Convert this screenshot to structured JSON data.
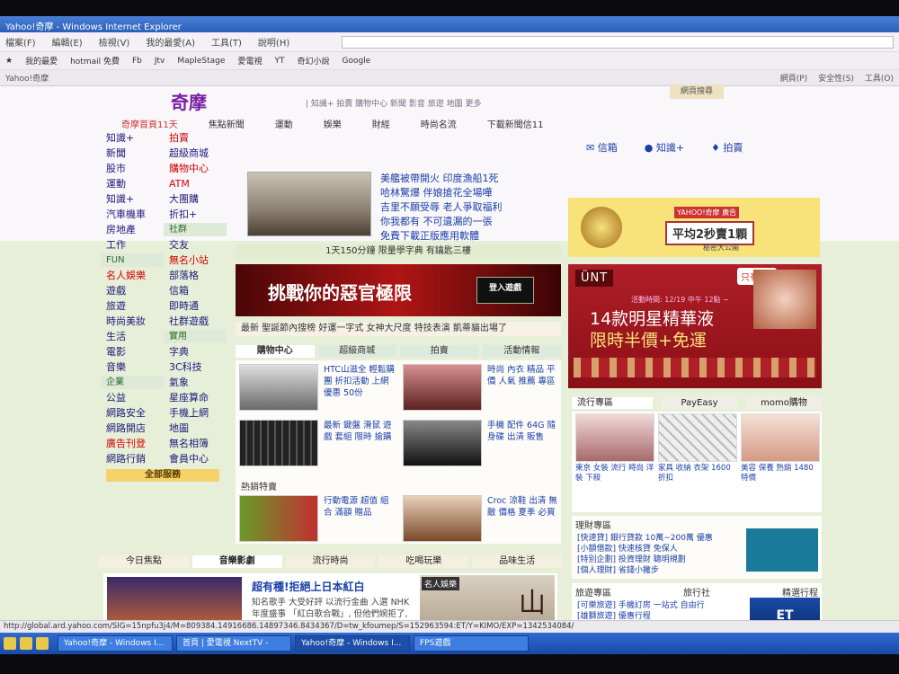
{
  "window": {
    "title": "Yahoo!奇摩 - Windows Internet Explorer"
  },
  "menubar": {
    "items": [
      "檔案(F)",
      "編輯(E)",
      "檢視(V)",
      "我的最愛(A)",
      "工具(T)",
      "說明(H)"
    ]
  },
  "favbar": {
    "items": [
      "我的最愛",
      "hotmail 免費",
      "Fb",
      "Jtv",
      "MapleStage",
      "愛電視",
      "YT",
      "奇幻小說",
      "Google"
    ]
  },
  "tabbar": {
    "tab": "Yahoo!奇摩",
    "tools": [
      "網頁(P)",
      "安全性(S)",
      "工具(O)"
    ]
  },
  "header": {
    "logo": "奇摩",
    "top_right": "網頁搜尋",
    "search_links": "| 知識+ 拍賣 購物中心 新聞 影音 旅遊 地圖 更多"
  },
  "navrow": [
    "奇摩首頁11天",
    "焦點新聞",
    "運動",
    "娛樂",
    "財經",
    "時尚名流",
    "下載新聞信11"
  ],
  "leftnav": {
    "rows": [
      [
        "知識+",
        "拍賣"
      ],
      [
        "新聞",
        "超級商城"
      ],
      [
        "股市",
        "購物中心"
      ],
      [
        "運動",
        "ATM"
      ],
      [
        "知識+",
        "大團購"
      ],
      [
        "汽車機車",
        "折扣+"
      ],
      [
        "房地產",
        "社群"
      ],
      [
        "工作",
        "交友"
      ],
      [
        "FUN",
        "無名小站"
      ],
      [
        "名人娛樂",
        "部落格"
      ],
      [
        "遊戲",
        "信箱"
      ],
      [
        "旅遊",
        "即時通"
      ],
      [
        "時尚美妝",
        "社群遊戲"
      ],
      [
        "生活",
        "實用"
      ],
      [
        "電影",
        "字典"
      ],
      [
        "音樂",
        "3C科技"
      ],
      [
        "企業",
        "氣象"
      ],
      [
        "公益",
        "星座算命"
      ],
      [
        "網路安全",
        "手機上網"
      ],
      [
        "網路開店",
        "地圖"
      ],
      [
        "廣告刊登",
        "無名相簿"
      ],
      [
        "網路行銷",
        "會員中心"
      ]
    ],
    "all_services": "全部服務"
  },
  "news": {
    "items": [
      "美艦被帶開火 印度漁船1死",
      "哈林驚爆 伴娘搶花全場嘩",
      "吉里不願受辱 老人爭取福利",
      "你我都有 不可遺漏的一張",
      "免費下載正版應用軟體"
    ]
  },
  "banner1": "1天150分鐘 限量學字典 有鑰匙三樓",
  "ad": {
    "headline": "挑戰你的惡官極限",
    "button": "登入遊戲"
  },
  "ticker": "最新 聖誕節內搜榜  好運一字式  女神大尺度  特技表演  凱蒂貓出場了",
  "shop_tabs": [
    "購物中心",
    "超級商城",
    "拍賣",
    "活動情報"
  ],
  "shop_items": [
    "HTC山滋全 輕鬆購團 折扣活動 上網優惠 50份",
    "時尚 內衣 精品 平價 人氣 推薦 專區",
    "最新 鍵盤 滑鼠 遊戲 套組 限時 搶購",
    "手機 配件 64G 隨身碟 出清 販售",
    "行動電源 超值 組合 滿額 贈品",
    "Croc 涼鞋 出清 無敵 價格 夏季 必買"
  ],
  "hot_section": "熱銷特賣",
  "lower_tabs": [
    "今日焦點",
    "音樂影劇",
    "流行時尚",
    "吃喝玩樂",
    "品味生活"
  ],
  "feature": {
    "title": "超有種!拒絕上日本紅白",
    "body": "知名歌手 大受好評 以流行金曲 入選 NHK 年度盛事 「紅白歌合戰」, 但他們婉拒了, 選擇在家跨年",
    "badge": "名人娛樂",
    "big": "山"
  },
  "services": [
    "信箱",
    "知識+",
    "拍賣"
  ],
  "kiwi": {
    "tag": "YAHOO!奇摩 廣告",
    "headline": "平均2秒賣1顆",
    "sub": "秘密大公開"
  },
  "unt": {
    "logo": "ÜNT",
    "badge": "只有3天",
    "small": "活動時間: 12/19 中午 12點 ~",
    "line1": "14款明星精華液",
    "line2": "限時半價+免運"
  },
  "right_tabs": [
    "流行專區",
    "PayEasy",
    "momo購物"
  ],
  "fashion": [
    "東京 女裝 流行 時尚 洋裝 下殺",
    "家具 收納 衣架 1600 折扣",
    "美容 保養 熱銷 1480 特價"
  ],
  "finance": {
    "title": "理財專區",
    "items": [
      "[快速貸] 銀行貸款 10萬~200萬 優惠",
      "[小額借款] 快速核貸 免保人",
      "[特別企劃] 投資理財 聰明規劃",
      "[個人理財] 省錢小撇步"
    ]
  },
  "travel": {
    "title": "旅遊專區",
    "subtitle": "旅行社",
    "link": "精選行程",
    "items": [
      "[可樂旅遊] 手機訂房 一站式 自由行",
      "[雄獅旅遊] 優惠行程"
    ],
    "ad": "ET"
  },
  "statusbar": "http://global.ard.yahoo.com/SIG=15npfu3j4/M=809384.14916686.14897346.8434367/D=tw_kfoumep/S=152963594:ET/Y=KIMO/EXP=1342534084/",
  "taskbar": [
    "Yahoo!奇摩 - Windows I...",
    "首頁 | 愛電視 NextTV -",
    "Yahoo!奇摩 - Windows I...",
    "FPS遊戲"
  ]
}
